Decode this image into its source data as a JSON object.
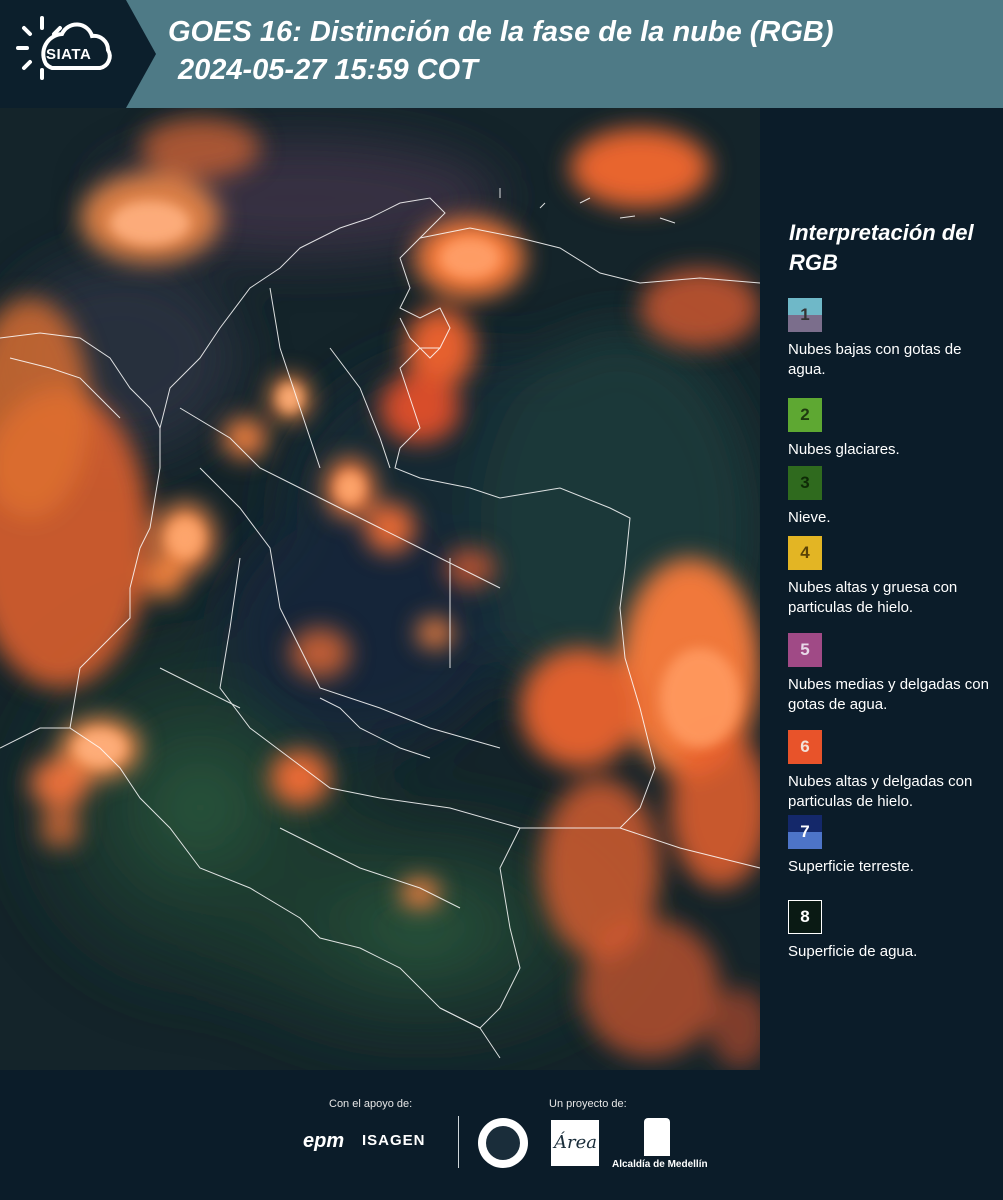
{
  "header": {
    "logo_text": "SIATA",
    "title_line1": "GOES 16: Distinción de la fase de la nube (RGB)",
    "title_line2": "2024-05-27 15:59 COT"
  },
  "legend": {
    "title": "Interpretación del RGB",
    "items": [
      {
        "number": "1",
        "label": "Nubes bajas con gotas de agua.",
        "color_top": "#6fb8c8",
        "color_bottom": "#7b6e8c",
        "text_color": "#333333"
      },
      {
        "number": "2",
        "label": "Nubes glaciares.",
        "color_top": "#5ea832",
        "color_bottom": "#5ea832",
        "text_color": "#1e3a10"
      },
      {
        "number": "3",
        "label": "Nieve.",
        "color_top": "#2f6a1e",
        "color_bottom": "#2f6a1e",
        "text_color": "#0e2a06"
      },
      {
        "number": "4",
        "label": "Nubes altas y gruesa con particulas de hielo.",
        "color_top": "#e3b524",
        "color_bottom": "#e3b524",
        "text_color": "#5a4206"
      },
      {
        "number": "5",
        "label": "Nubes medias y delgadas con gotas de agua.",
        "color_top": "#a04a86",
        "color_bottom": "#a04a86",
        "text_color": "#e8d8e8"
      },
      {
        "number": "6",
        "label": "Nubes altas y delgadas con particulas de hielo.",
        "color_top": "#e8532a",
        "color_bottom": "#e8532a",
        "text_color": "#f2e0d8"
      },
      {
        "number": "7",
        "label": "Superficie terreste.",
        "color_top": "#14286a",
        "color_bottom": "#4d74c8",
        "text_color": "#ffffff"
      },
      {
        "number": "8",
        "label": "Superficie de agua.",
        "color_top": "#0a1a14",
        "color_bottom": "#0a1a14",
        "text_color": "#ffffff"
      }
    ]
  },
  "footer": {
    "support_caption": "Con el apoyo de:",
    "project_caption": "Un proyecto de:",
    "epm_text": "epm",
    "isagen_text": "ISAGEN",
    "area_text": "Área",
    "alcaldia_text": "Alcaldía de Medellín"
  }
}
